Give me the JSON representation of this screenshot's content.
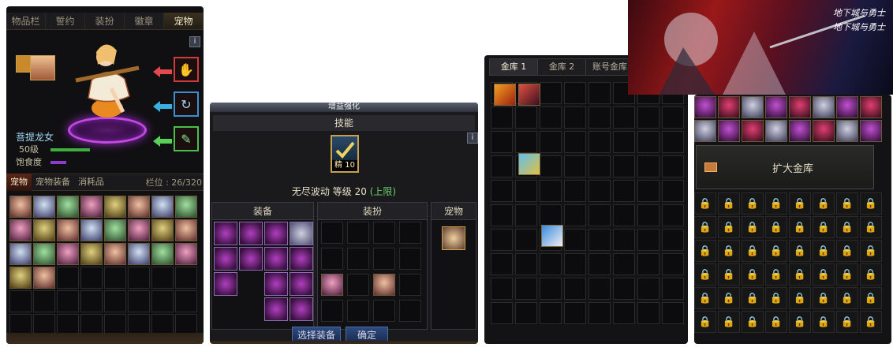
{
  "pet_window": {
    "tabs": [
      "物品栏",
      "誓约",
      "装扮",
      "徽章",
      "宠物"
    ],
    "active_tab": "宠物",
    "info_label": "i",
    "pet_name": "菩提龙女",
    "level_label": "50级",
    "hunger_label": "饱食度",
    "sub_tabs": [
      "宠物",
      "宠物装备",
      "消耗品"
    ],
    "slot_label": "栏位 : 26/320",
    "slot_arrows": [
      "red",
      "blue",
      "green"
    ],
    "colors": {
      "accent": "#c14ae0",
      "name": "#9fd7f4",
      "level_bar": "#3fae3f",
      "hunger_bar": "#8e3ad0"
    }
  },
  "enhance_window": {
    "title": "增益强化",
    "skill_header": "技能",
    "skill_icon_level": "精 10",
    "skill_name": "无尽波动",
    "skill_level_text": "等级 20",
    "skill_cap": "(上限)",
    "columns": [
      "装备",
      "装扮",
      "宠物"
    ],
    "buttons": [
      "选择装备",
      "确定"
    ],
    "info_label": "i"
  },
  "bank_window": {
    "tabs": [
      "金库 1",
      "金库 2",
      "账号金库"
    ],
    "active_tab": "金库 1"
  },
  "bank_window_2": {
    "expand_label": "扩大金库"
  },
  "banner": {
    "logo_top": "地下城与勇士",
    "logo_bottom": "地下城与勇士"
  }
}
